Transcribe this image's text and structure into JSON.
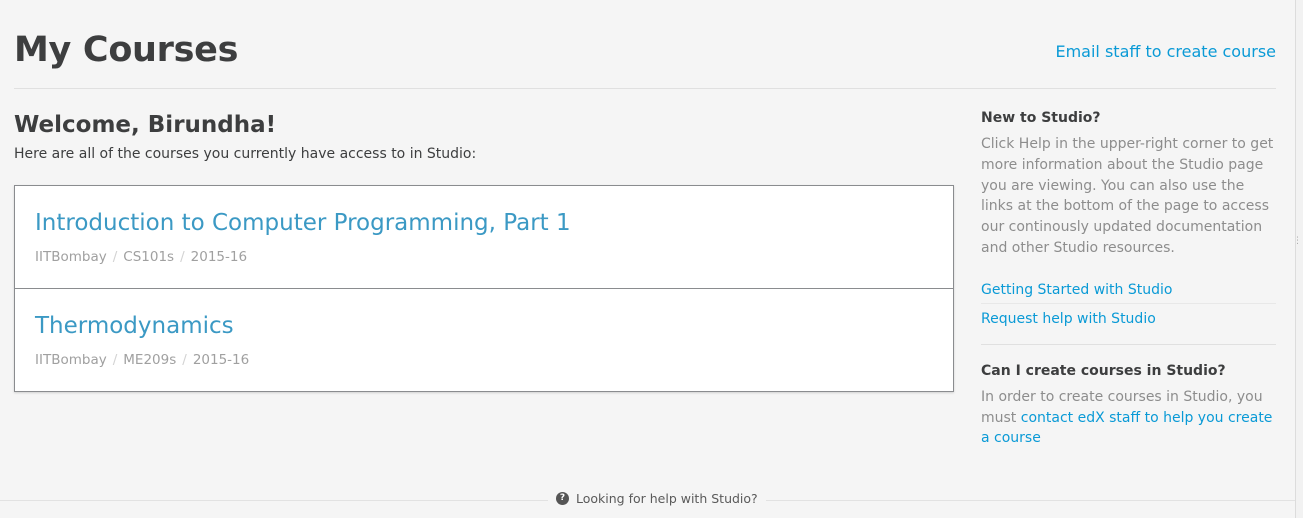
{
  "header": {
    "title": "My Courses",
    "email_link": "Email staff to create course"
  },
  "main": {
    "welcome": "Welcome, Birundha!",
    "subtitle": "Here are all of the courses you currently have access to in Studio:"
  },
  "courses": [
    {
      "title": "Introduction to Computer Programming, Part 1",
      "org": "IITBombay",
      "number": "CS101s",
      "run": "2015-16"
    },
    {
      "title": "Thermodynamics",
      "org": "IITBombay",
      "number": "ME209s",
      "run": "2015-16"
    }
  ],
  "meta_separator": "/",
  "sidebar": {
    "new_heading": "New to Studio?",
    "new_text": "Click Help in the upper-right corner to get more information about the Studio page you are viewing. You can also use the links at the bottom of the page to access our continously updated documentation and other Studio resources.",
    "links": [
      "Getting Started with Studio",
      "Request help with Studio"
    ],
    "create_heading": "Can I create courses in Studio?",
    "create_text": "In order to create courses in Studio, you must",
    "create_link": "contact edX staff to help you create a course"
  },
  "footer": {
    "help_icon": "question-circle-icon",
    "help_glyph": "?",
    "help_text": "Looking for help with Studio?"
  },
  "colors": {
    "link": "#0a9ad6",
    "course_title": "#3b99c4"
  }
}
